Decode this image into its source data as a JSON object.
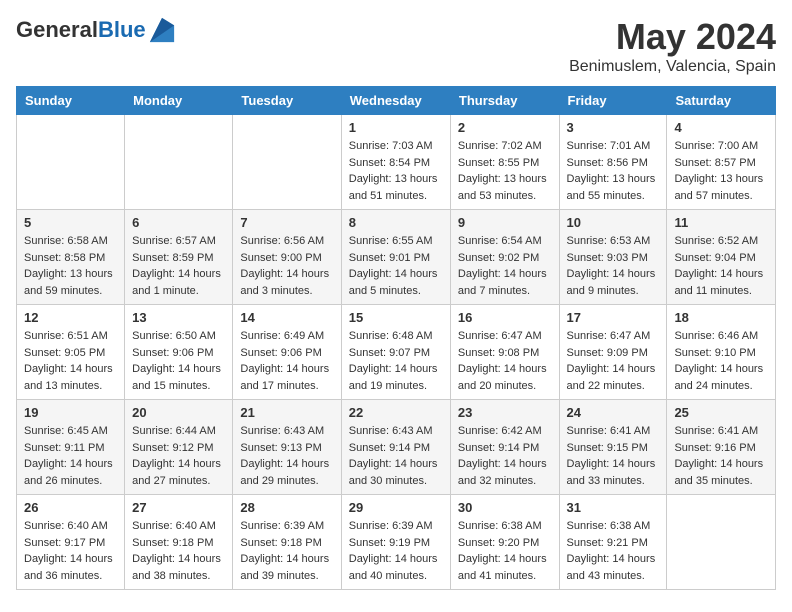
{
  "logo": {
    "general": "General",
    "blue": "Blue"
  },
  "header": {
    "month": "May 2024",
    "location": "Benimuslem, Valencia, Spain"
  },
  "weekdays": [
    "Sunday",
    "Monday",
    "Tuesday",
    "Wednesday",
    "Thursday",
    "Friday",
    "Saturday"
  ],
  "weeks": [
    [
      {
        "day": "",
        "sunrise": "",
        "sunset": "",
        "daylight": ""
      },
      {
        "day": "",
        "sunrise": "",
        "sunset": "",
        "daylight": ""
      },
      {
        "day": "",
        "sunrise": "",
        "sunset": "",
        "daylight": ""
      },
      {
        "day": "1",
        "sunrise": "Sunrise: 7:03 AM",
        "sunset": "Sunset: 8:54 PM",
        "daylight": "Daylight: 13 hours and 51 minutes."
      },
      {
        "day": "2",
        "sunrise": "Sunrise: 7:02 AM",
        "sunset": "Sunset: 8:55 PM",
        "daylight": "Daylight: 13 hours and 53 minutes."
      },
      {
        "day": "3",
        "sunrise": "Sunrise: 7:01 AM",
        "sunset": "Sunset: 8:56 PM",
        "daylight": "Daylight: 13 hours and 55 minutes."
      },
      {
        "day": "4",
        "sunrise": "Sunrise: 7:00 AM",
        "sunset": "Sunset: 8:57 PM",
        "daylight": "Daylight: 13 hours and 57 minutes."
      }
    ],
    [
      {
        "day": "5",
        "sunrise": "Sunrise: 6:58 AM",
        "sunset": "Sunset: 8:58 PM",
        "daylight": "Daylight: 13 hours and 59 minutes."
      },
      {
        "day": "6",
        "sunrise": "Sunrise: 6:57 AM",
        "sunset": "Sunset: 8:59 PM",
        "daylight": "Daylight: 14 hours and 1 minute."
      },
      {
        "day": "7",
        "sunrise": "Sunrise: 6:56 AM",
        "sunset": "Sunset: 9:00 PM",
        "daylight": "Daylight: 14 hours and 3 minutes."
      },
      {
        "day": "8",
        "sunrise": "Sunrise: 6:55 AM",
        "sunset": "Sunset: 9:01 PM",
        "daylight": "Daylight: 14 hours and 5 minutes."
      },
      {
        "day": "9",
        "sunrise": "Sunrise: 6:54 AM",
        "sunset": "Sunset: 9:02 PM",
        "daylight": "Daylight: 14 hours and 7 minutes."
      },
      {
        "day": "10",
        "sunrise": "Sunrise: 6:53 AM",
        "sunset": "Sunset: 9:03 PM",
        "daylight": "Daylight: 14 hours and 9 minutes."
      },
      {
        "day": "11",
        "sunrise": "Sunrise: 6:52 AM",
        "sunset": "Sunset: 9:04 PM",
        "daylight": "Daylight: 14 hours and 11 minutes."
      }
    ],
    [
      {
        "day": "12",
        "sunrise": "Sunrise: 6:51 AM",
        "sunset": "Sunset: 9:05 PM",
        "daylight": "Daylight: 14 hours and 13 minutes."
      },
      {
        "day": "13",
        "sunrise": "Sunrise: 6:50 AM",
        "sunset": "Sunset: 9:06 PM",
        "daylight": "Daylight: 14 hours and 15 minutes."
      },
      {
        "day": "14",
        "sunrise": "Sunrise: 6:49 AM",
        "sunset": "Sunset: 9:06 PM",
        "daylight": "Daylight: 14 hours and 17 minutes."
      },
      {
        "day": "15",
        "sunrise": "Sunrise: 6:48 AM",
        "sunset": "Sunset: 9:07 PM",
        "daylight": "Daylight: 14 hours and 19 minutes."
      },
      {
        "day": "16",
        "sunrise": "Sunrise: 6:47 AM",
        "sunset": "Sunset: 9:08 PM",
        "daylight": "Daylight: 14 hours and 20 minutes."
      },
      {
        "day": "17",
        "sunrise": "Sunrise: 6:47 AM",
        "sunset": "Sunset: 9:09 PM",
        "daylight": "Daylight: 14 hours and 22 minutes."
      },
      {
        "day": "18",
        "sunrise": "Sunrise: 6:46 AM",
        "sunset": "Sunset: 9:10 PM",
        "daylight": "Daylight: 14 hours and 24 minutes."
      }
    ],
    [
      {
        "day": "19",
        "sunrise": "Sunrise: 6:45 AM",
        "sunset": "Sunset: 9:11 PM",
        "daylight": "Daylight: 14 hours and 26 minutes."
      },
      {
        "day": "20",
        "sunrise": "Sunrise: 6:44 AM",
        "sunset": "Sunset: 9:12 PM",
        "daylight": "Daylight: 14 hours and 27 minutes."
      },
      {
        "day": "21",
        "sunrise": "Sunrise: 6:43 AM",
        "sunset": "Sunset: 9:13 PM",
        "daylight": "Daylight: 14 hours and 29 minutes."
      },
      {
        "day": "22",
        "sunrise": "Sunrise: 6:43 AM",
        "sunset": "Sunset: 9:14 PM",
        "daylight": "Daylight: 14 hours and 30 minutes."
      },
      {
        "day": "23",
        "sunrise": "Sunrise: 6:42 AM",
        "sunset": "Sunset: 9:14 PM",
        "daylight": "Daylight: 14 hours and 32 minutes."
      },
      {
        "day": "24",
        "sunrise": "Sunrise: 6:41 AM",
        "sunset": "Sunset: 9:15 PM",
        "daylight": "Daylight: 14 hours and 33 minutes."
      },
      {
        "day": "25",
        "sunrise": "Sunrise: 6:41 AM",
        "sunset": "Sunset: 9:16 PM",
        "daylight": "Daylight: 14 hours and 35 minutes."
      }
    ],
    [
      {
        "day": "26",
        "sunrise": "Sunrise: 6:40 AM",
        "sunset": "Sunset: 9:17 PM",
        "daylight": "Daylight: 14 hours and 36 minutes."
      },
      {
        "day": "27",
        "sunrise": "Sunrise: 6:40 AM",
        "sunset": "Sunset: 9:18 PM",
        "daylight": "Daylight: 14 hours and 38 minutes."
      },
      {
        "day": "28",
        "sunrise": "Sunrise: 6:39 AM",
        "sunset": "Sunset: 9:18 PM",
        "daylight": "Daylight: 14 hours and 39 minutes."
      },
      {
        "day": "29",
        "sunrise": "Sunrise: 6:39 AM",
        "sunset": "Sunset: 9:19 PM",
        "daylight": "Daylight: 14 hours and 40 minutes."
      },
      {
        "day": "30",
        "sunrise": "Sunrise: 6:38 AM",
        "sunset": "Sunset: 9:20 PM",
        "daylight": "Daylight: 14 hours and 41 minutes."
      },
      {
        "day": "31",
        "sunrise": "Sunrise: 6:38 AM",
        "sunset": "Sunset: 9:21 PM",
        "daylight": "Daylight: 14 hours and 43 minutes."
      },
      {
        "day": "",
        "sunrise": "",
        "sunset": "",
        "daylight": ""
      }
    ]
  ]
}
